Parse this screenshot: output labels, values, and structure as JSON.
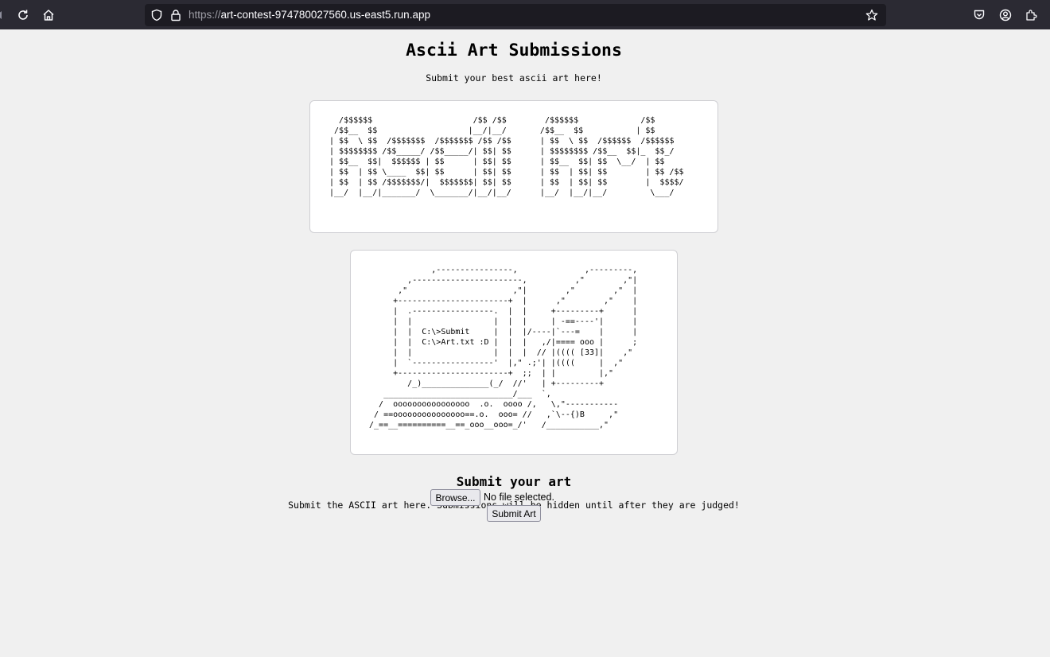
{
  "browser": {
    "url_scheme": "https://",
    "url_host": "art-contest-974780027560.us-east5.run.app"
  },
  "header": {
    "title": "Ascii Art Submissions",
    "subtitle": "Submit your best ascii art here!"
  },
  "gallery": {
    "art_1": "   /$$$$$$                     /$$ /$$        /$$$$$$             /$$\n  /$$__  $$                   |__/|__/       /$$__  $$           | $$\n | $$  \\ $$  /$$$$$$$  /$$$$$$$ /$$ /$$      | $$  \\ $$  /$$$$$$  /$$$$$$\n | $$$$$$$$ /$$_____/ /$$_____/| $$| $$      | $$$$$$$$ /$$__  $$|_  $$_/\n | $$__  $$|  $$$$$$ | $$      | $$| $$      | $$__  $$| $$  \\__/  | $$\n | $$  | $$ \\____  $$| $$      | $$| $$      | $$  | $$| $$        | $$ /$$\n | $$  | $$ /$$$$$$$/|  $$$$$$$| $$| $$      | $$  | $$| $$        |  $$$$/\n |__/  |__/|_______/  \\_______/|__/|__/      |__/  |__/|__/         \\___/",
    "art_2": "              ,----------------,              ,---------,\n         ,-----------------------,          ,\"        ,\"|\n       ,\"                      ,\"|        ,\"        ,\"  |\n      +-----------------------+  |      ,\"        ,\"    |\n      |  .-----------------.  |  |     +---------+      |\n      |  |                 |  |  |     | -==----'|      |\n      |  |  C:\\>Submit     |  |  |/----|`---=    |      |\n      |  |  C:\\>Art.txt :D |  |  |   ,/|==== ooo |      ;\n      |  |                 |  |  |  // |(((( [33]|    ,\"\n      |  `-----------------'  |,\" .;'| |((((     |  ,\"\n      +-----------------------+  ;;  | |         |,\"\n         /_)______________(_/  //'   | +---------+\n    ___________________________/___  `,\n   /  oooooooooooooooo  .o.  oooo /,   \\,\"-----------\n  / ==ooooooooooooooo==.o.  ooo= //   ,`\\--{)B     ,\"\n /_==__==========__==_ooo__ooo=_/'   /___________,\""
  },
  "submit": {
    "heading": "Submit your art",
    "description": "Submit the ASCII art here. Submissions will be hidden until after they are judged!",
    "browse_label": "Browse...",
    "no_file_text": "No file selected.",
    "submit_label": "Submit Art"
  }
}
